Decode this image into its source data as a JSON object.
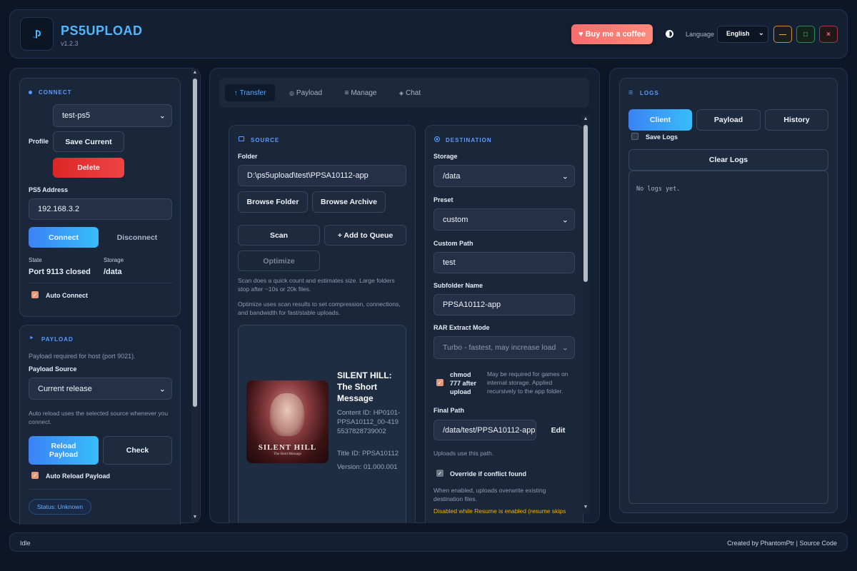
{
  "app": {
    "title": "PS5UPLOAD",
    "version": "v1.2.3"
  },
  "header": {
    "coffee_label": "♥ Buy me a coffee",
    "language_label": "Language",
    "language_value": "English",
    "win_min": "—",
    "win_max": "□",
    "win_close": "×"
  },
  "connect": {
    "title": "CONNECT",
    "profile_label": "Profile",
    "profile_value": "test-ps5",
    "save_current": "Save Current",
    "delete": "Delete",
    "address_label": "PS5 Address",
    "address_value": "192.168.3.2",
    "connect_btn": "Connect",
    "disconnect_btn": "Disconnect",
    "state_label": "State",
    "state_value": "Port 9113 closed",
    "storage_label": "Storage",
    "storage_value": "/data",
    "auto_connect": "Auto Connect"
  },
  "payload": {
    "title": "PAYLOAD",
    "required_note": "Payload required for host (port 9021).",
    "source_label": "Payload Source",
    "source_value": "Current release",
    "auto_reload_note": "Auto reload uses the selected source whenever you connect.",
    "reload_btn": "Reload Payload",
    "check_btn": "Check",
    "auto_reload_label": "Auto Reload Payload",
    "status_badge": "Status: Unknown"
  },
  "tabs": [
    {
      "icon": "↑",
      "label": "Transfer"
    },
    {
      "icon": "◎",
      "label": "Payload"
    },
    {
      "icon": "≡",
      "label": "Manage"
    },
    {
      "icon": "◈",
      "label": "Chat"
    }
  ],
  "source": {
    "title": "SOURCE",
    "folder_label": "Folder",
    "folder_value": "D:\\ps5upload\\test\\PPSA10112-app",
    "browse_folder": "Browse Folder",
    "browse_archive": "Browse Archive",
    "scan": "Scan",
    "add_queue": "+ Add to Queue",
    "optimize": "Optimize",
    "scan_note": "Scan does a quick count and estimates size. Large folders stop after ~10s or 20k files.",
    "optimize_note": "Optimize uses scan results to set compression, connections, and bandwidth for fast/stable uploads.",
    "game": {
      "cover_title": "SILENT HILL",
      "cover_sub": "The Short Message",
      "title": "SILENT HILL: The Short Message",
      "content_id": "Content ID: HP0101-PPSA10112_00-4195537828739002",
      "title_id": "Title ID: PPSA10112",
      "version": "Version: 01.000.001"
    }
  },
  "destination": {
    "title": "DESTINATION",
    "storage_label": "Storage",
    "storage_value": "/data",
    "preset_label": "Preset",
    "preset_value": "custom",
    "custom_path_label": "Custom Path",
    "custom_path_value": "test",
    "subfolder_label": "Subfolder Name",
    "subfolder_value": "PPSA10112-app",
    "rar_label": "RAR Extract Mode",
    "rar_value": "Turbo - fastest, may increase load",
    "chmod_label": "chmod 777 after upload",
    "chmod_note": "May be required for games on internal storage. Applied recursively to the app folder.",
    "final_path_label": "Final Path",
    "final_path_value": "/data/test/PPSA10112-app",
    "edit_btn": "Edit",
    "uploads_note": "Uploads use this path.",
    "override_label": "Override if conflict found",
    "override_note": "When enabled, uploads overwrite existing destination files.",
    "warning": "Disabled while Resume is enabled (resume skips"
  },
  "logs": {
    "title": "LOGS",
    "tabs": [
      "Client",
      "Payload",
      "History"
    ],
    "save_logs": "Save Logs",
    "clear": "Clear Logs",
    "empty": "No logs yet."
  },
  "footer": {
    "status": "Idle",
    "credits": "Created by PhantomPtr | Source Code"
  },
  "colors": {
    "accent": "#4fb8ff",
    "section": "#5a9cff",
    "danger": "#ef4444",
    "warning": "#f5b301"
  }
}
